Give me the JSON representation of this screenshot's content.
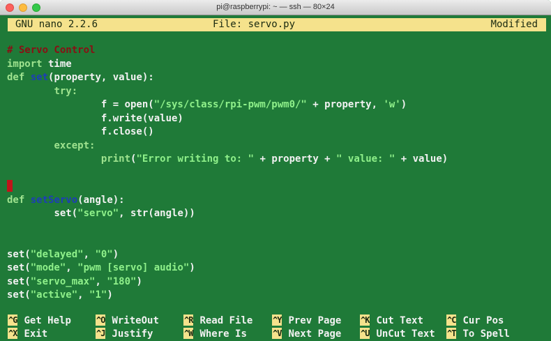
{
  "window": {
    "title": "pi@raspberrypi: ~ — ssh — 80×24"
  },
  "nano": {
    "version": "GNU nano 2.2.6",
    "file": "File: servo.py",
    "status": "Modified"
  },
  "code": {
    "l1": "# Servo Control",
    "l2_kw": "import",
    "l2_rest": " time",
    "l3_kw": "def",
    "l3_fn": "set",
    "l3_rest": "(property, value):",
    "l4": "try:",
    "l5_a": "f = open(",
    "l5_s": "\"/sys/class/rpi-pwm/pwm0/\"",
    "l5_b": " + property, ",
    "l5_s2": "'w'",
    "l5_c": ")",
    "l6": "f.write(value)",
    "l7": "f.close()",
    "l8": "except:",
    "l9_kw": "print",
    "l9_a": "(",
    "l9_s": "\"Error writing to: \"",
    "l9_b": " + property + ",
    "l9_s2": "\" value: \"",
    "l9_c": " + value)",
    "l11_kw": "def",
    "l11_fn": "setServo",
    "l11_rest": "(angle):",
    "l12_a": "set(",
    "l12_s": "\"servo\"",
    "l12_b": ", str(angle))",
    "l14_a": "set(",
    "l14_s": "\"delayed\"",
    "l14_b": ", ",
    "l14_s2": "\"0\"",
    "l14_c": ")",
    "l15_a": "set(",
    "l15_s": "\"mode\"",
    "l15_b": ", ",
    "l15_s2": "\"pwm [servo] audio\"",
    "l15_c": ")",
    "l16_a": "set(",
    "l16_s": "\"servo_max\"",
    "l16_b": ", ",
    "l16_s2": "\"180\"",
    "l16_c": ")",
    "l17_a": "set(",
    "l17_s": "\"active\"",
    "l17_b": ", ",
    "l17_s2": "\"1\"",
    "l17_c": ")"
  },
  "shortcuts": {
    "row1": [
      {
        "key": "^G",
        "label": "Get Help"
      },
      {
        "key": "^O",
        "label": "WriteOut"
      },
      {
        "key": "^R",
        "label": "Read File"
      },
      {
        "key": "^Y",
        "label": "Prev Page"
      },
      {
        "key": "^K",
        "label": "Cut Text"
      },
      {
        "key": "^C",
        "label": "Cur Pos"
      }
    ],
    "row2": [
      {
        "key": "^X",
        "label": "Exit"
      },
      {
        "key": "^J",
        "label": "Justify"
      },
      {
        "key": "^W",
        "label": "Where Is"
      },
      {
        "key": "^V",
        "label": "Next Page"
      },
      {
        "key": "^U",
        "label": "UnCut Text"
      },
      {
        "key": "^T",
        "label": "To Spell"
      }
    ]
  },
  "colors": {
    "terminal_bg": "#1f7a38",
    "header_bg": "#f5e28c",
    "comment": "#8a0f14",
    "function_name": "#1d3db8",
    "string": "#8ff08a",
    "cursor": "#c0151a"
  }
}
